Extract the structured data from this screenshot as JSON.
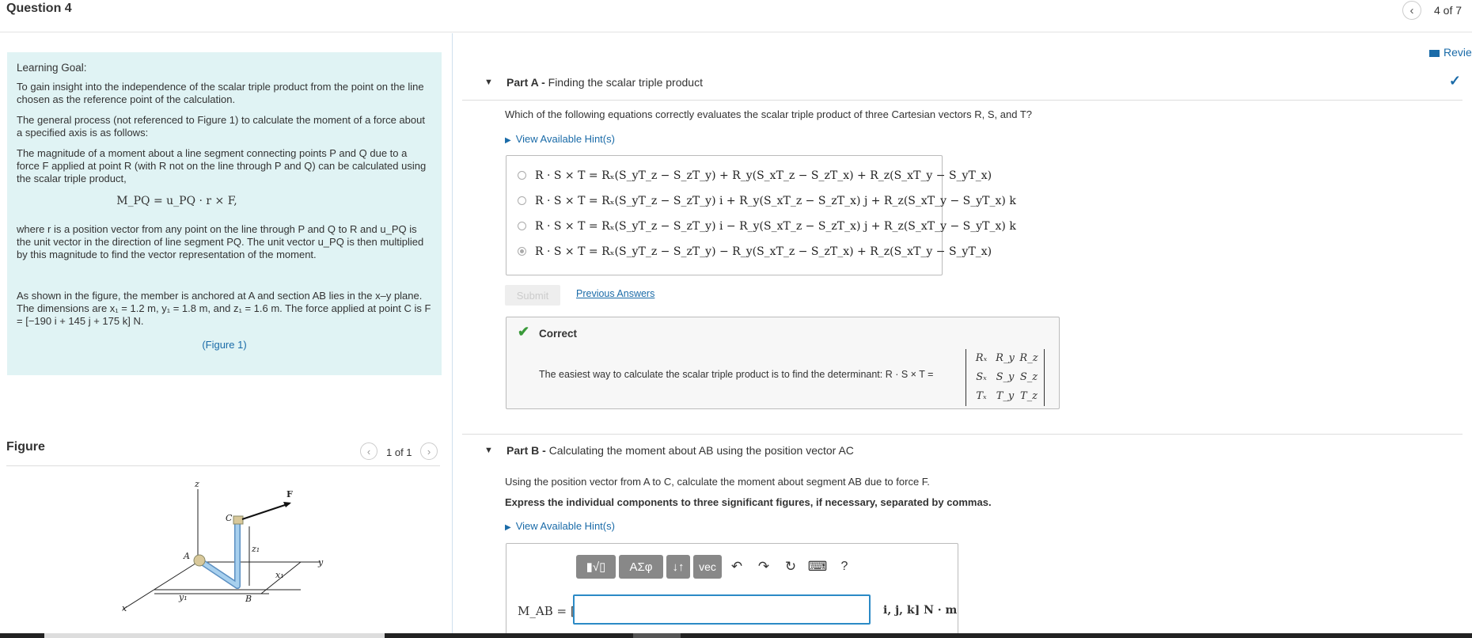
{
  "header": {
    "question_title": "Question 4",
    "prev_icon": "chevron-left-icon",
    "pager": "4 of 7",
    "review_label": "Revie"
  },
  "goal": {
    "heading": "Learning Goal:",
    "p1": "To gain insight into the independence of the scalar triple product from the point on the line chosen as the reference point of the calculation.",
    "p2": "The general process (not referenced to Figure 1) to calculate the moment of a force about a specified axis is as follows:",
    "p3": "The magnitude of a moment about a line segment connecting points P and Q due to a force F applied at point R (with R not on the line through P and Q) can be calculated using the scalar triple product,",
    "formula": "M_PQ = u_PQ · r × F,",
    "p4": "where r is a position vector from any point on the line through P and Q to R and u_PQ is the unit vector in the direction of line segment PQ. The unit vector u_PQ is then multiplied by this magnitude to find the vector representation of the moment.",
    "p5": "As shown in the figure, the member is anchored at A and section AB lies in the x–y plane. The dimensions are x₁ = 1.2 m, y₁ = 1.8 m, and z₁ = 1.6 m. The force applied at point C is F = [−190 i + 145 j + 175 k] N.",
    "figure_link": "(Figure 1)"
  },
  "figure_panel": {
    "heading": "Figure",
    "pager": "1 of 1",
    "labels": {
      "z": "z",
      "F": "F",
      "C": "C",
      "A": "A",
      "z1": "z₁",
      "x1": "x₁",
      "y": "y",
      "y1": "y₁",
      "B": "B",
      "x": "x"
    }
  },
  "part_a": {
    "label": "Part A -",
    "title": "Finding the scalar triple product",
    "question": "Which of the following equations correctly evaluates the scalar triple product of three Cartesian vectors R, S, and T?",
    "hint": "View Available Hint(s)",
    "options": [
      "R · S × T = Rₓ(S_yT_z − S_zT_y) + R_y(S_xT_z − S_zT_x) + R_z(S_xT_y − S_yT_x)",
      "R · S × T = Rₓ(S_yT_z − S_zT_y) i + R_y(S_xT_z − S_zT_x) j + R_z(S_xT_y − S_yT_x) k",
      "R · S × T = Rₓ(S_yT_z − S_zT_y) i − R_y(S_xT_z − S_zT_x) j + R_z(S_xT_y − S_yT_x) k",
      "R · S × T = Rₓ(S_yT_z − S_zT_y) − R_y(S_xT_z − S_zT_x) + R_z(S_xT_y − S_yT_x)"
    ],
    "selected_index": 3,
    "submit": "Submit",
    "previous_answers": "Previous Answers",
    "correct_label": "Correct",
    "feedback": "The easiest way to calculate the scalar triple product is to find the determinant: R · S × T =",
    "det": [
      "Rₓ",
      "R_y",
      "R_z",
      "Sₓ",
      "S_y",
      "S_z",
      "Tₓ",
      "T_y",
      "T_z"
    ]
  },
  "part_b": {
    "label": "Part B -",
    "title": "Calculating the moment about AB using the position vector AC",
    "question": "Using the position vector from A to C, calculate the moment about segment AB due to force F.",
    "instruction": "Express the individual components to three significant figures, if necessary, separated by commas.",
    "hint": "View Available Hint(s)",
    "toolbar": {
      "templates": "▮√▯",
      "symbols": "ΑΣφ",
      "arrows": "↓↑",
      "vec": "vec",
      "help": "?"
    },
    "input_label": "M_AB = [",
    "input_value": "",
    "units": "i, j, k] N · m"
  }
}
